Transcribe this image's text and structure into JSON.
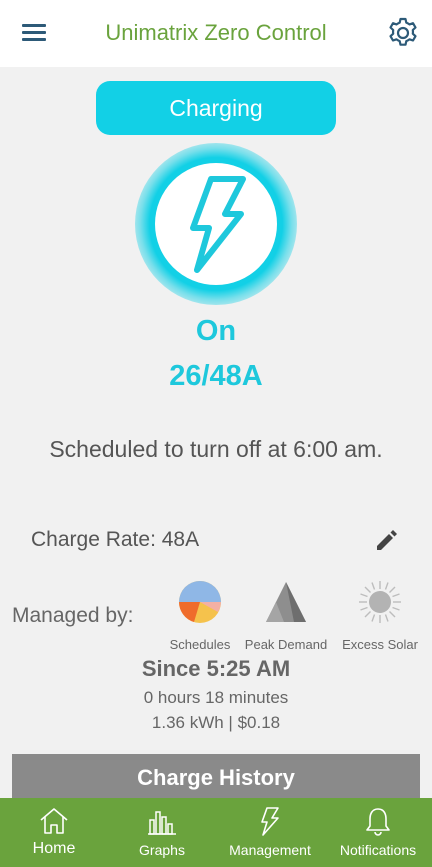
{
  "header": {
    "title": "Unimatrix Zero Control",
    "menu_icon": "hamburger-menu-icon",
    "settings_icon": "gear-icon"
  },
  "status": {
    "label": "Charging",
    "state": "On",
    "current": "26/48A",
    "schedule_message": "Scheduled to turn off at 6:00 am.",
    "icon": "lightning-bolt-icon"
  },
  "charge_rate": {
    "label": "Charge Rate: 48A",
    "edit_icon": "pencil-icon"
  },
  "managed_by": {
    "label": "Managed by:",
    "items": [
      {
        "label": "Schedules",
        "icon": "pie-chart-icon"
      },
      {
        "label": "Peak Demand",
        "icon": "mountain-icon"
      },
      {
        "label": "Excess Solar",
        "icon": "sun-icon"
      }
    ]
  },
  "session": {
    "since": "Since 5:25 AM",
    "duration": "0 hours 18 minutes",
    "energy": "1.36 kWh | $0.18"
  },
  "charge_history_label": "Charge History",
  "nav": {
    "items": [
      {
        "label": "Home",
        "icon": "home-icon",
        "active": true
      },
      {
        "label": "Graphs",
        "icon": "bar-chart-icon",
        "active": false
      },
      {
        "label": "Management",
        "icon": "lightning-icon",
        "active": false
      },
      {
        "label": "Notifications",
        "icon": "bell-icon",
        "active": false
      }
    ]
  },
  "colors": {
    "accent_green": "#6aa33d",
    "accent_cyan": "#12d0e6",
    "text_gray": "#555555",
    "button_gray": "#8a8a8a",
    "background": "#f1f1f1"
  }
}
